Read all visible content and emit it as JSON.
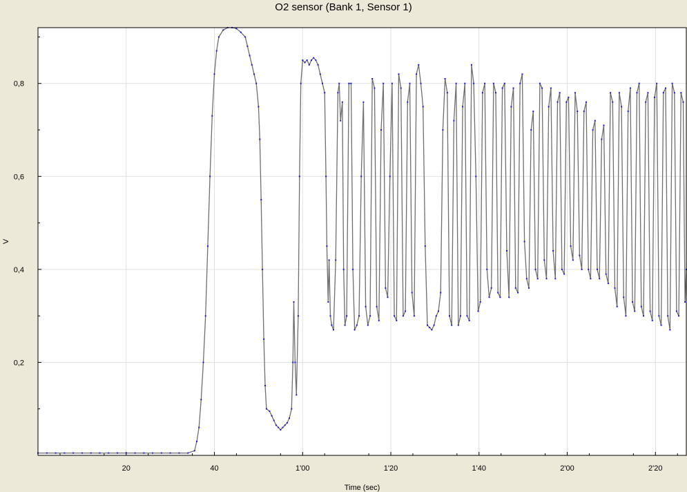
{
  "chart_data": {
    "type": "line",
    "title": "O2 sensor (Bank 1, Sensor 1)",
    "xlabel": "Time (sec)",
    "ylabel": "V",
    "xlim": [
      0,
      147
    ],
    "ylim": [
      0.0,
      0.92
    ],
    "grid": true,
    "x_ticks": [
      {
        "value": 20,
        "label": "20"
      },
      {
        "value": 40,
        "label": "40"
      },
      {
        "value": 60,
        "label": "1'00"
      },
      {
        "value": 80,
        "label": "1'20"
      },
      {
        "value": 100,
        "label": "1'40"
      },
      {
        "value": 120,
        "label": "2'00"
      },
      {
        "value": 140,
        "label": "2'20"
      }
    ],
    "y_ticks": [
      {
        "value": 0.2,
        "label": "0,2"
      },
      {
        "value": 0.4,
        "label": "0,4"
      },
      {
        "value": 0.6,
        "label": "0,6"
      },
      {
        "value": 0.8,
        "label": "0,8"
      }
    ],
    "colors": {
      "line": "#6e6e6e",
      "marker": "#1a1ad6",
      "grid": "#e0e0e0",
      "background": "#ffffff",
      "frame": "#ece9d8"
    },
    "series": [
      {
        "points": [
          [
            0,
            0.005
          ],
          [
            2,
            0.005
          ],
          [
            4,
            0.005
          ],
          [
            6,
            0.005
          ],
          [
            8,
            0.005
          ],
          [
            10,
            0.005
          ],
          [
            12,
            0.005
          ],
          [
            14,
            0.005
          ],
          [
            16,
            0.005
          ],
          [
            18,
            0.005
          ],
          [
            20,
            0.005
          ],
          [
            22,
            0.005
          ],
          [
            24,
            0.005
          ],
          [
            26,
            0.005
          ],
          [
            28,
            0.005
          ],
          [
            30,
            0.005
          ],
          [
            32,
            0.005
          ],
          [
            34,
            0.005
          ],
          [
            35.5,
            0.01
          ],
          [
            36,
            0.03
          ],
          [
            36.5,
            0.06
          ],
          [
            37,
            0.12
          ],
          [
            37.5,
            0.2
          ],
          [
            38,
            0.3
          ],
          [
            38.5,
            0.45
          ],
          [
            39,
            0.6
          ],
          [
            39.5,
            0.73
          ],
          [
            40,
            0.82
          ],
          [
            40.5,
            0.87
          ],
          [
            41,
            0.9
          ],
          [
            42,
            0.915
          ],
          [
            43,
            0.92
          ],
          [
            44,
            0.92
          ],
          [
            45,
            0.918
          ],
          [
            46,
            0.91
          ],
          [
            47,
            0.9
          ],
          [
            47.5,
            0.88
          ],
          [
            48,
            0.86
          ],
          [
            48.5,
            0.84
          ],
          [
            49,
            0.82
          ],
          [
            49.5,
            0.8
          ],
          [
            50,
            0.75
          ],
          [
            50.3,
            0.68
          ],
          [
            50.6,
            0.55
          ],
          [
            50.9,
            0.4
          ],
          [
            51.2,
            0.25
          ],
          [
            51.5,
            0.15
          ],
          [
            51.8,
            0.1
          ],
          [
            52.5,
            0.095
          ],
          [
            53,
            0.085
          ],
          [
            53.5,
            0.075
          ],
          [
            54,
            0.065
          ],
          [
            54.5,
            0.06
          ],
          [
            55,
            0.055
          ],
          [
            55.5,
            0.06
          ],
          [
            56,
            0.065
          ],
          [
            56.5,
            0.07
          ],
          [
            57,
            0.08
          ],
          [
            57.5,
            0.1
          ],
          [
            57.8,
            0.2
          ],
          [
            58,
            0.33
          ],
          [
            58.3,
            0.2
          ],
          [
            58.6,
            0.13
          ],
          [
            59,
            0.3
          ],
          [
            59.3,
            0.6
          ],
          [
            59.6,
            0.8
          ],
          [
            60,
            0.85
          ],
          [
            60.5,
            0.845
          ],
          [
            61,
            0.85
          ],
          [
            61.5,
            0.84
          ],
          [
            62,
            0.85
          ],
          [
            62.5,
            0.855
          ],
          [
            63,
            0.85
          ],
          [
            63.5,
            0.84
          ],
          [
            64,
            0.82
          ],
          [
            64.5,
            0.8
          ],
          [
            65,
            0.78
          ],
          [
            65.3,
            0.6
          ],
          [
            65.5,
            0.45
          ],
          [
            65.8,
            0.33
          ],
          [
            66,
            0.42
          ],
          [
            66.3,
            0.3
          ],
          [
            66.6,
            0.28
          ],
          [
            67,
            0.27
          ],
          [
            67.5,
            0.42
          ],
          [
            68,
            0.78
          ],
          [
            68.3,
            0.8
          ],
          [
            68.6,
            0.72
          ],
          [
            69,
            0.76
          ],
          [
            69.3,
            0.4
          ],
          [
            69.6,
            0.28
          ],
          [
            70,
            0.3
          ],
          [
            70.5,
            0.8
          ],
          [
            71,
            0.8
          ],
          [
            71.4,
            0.4
          ],
          [
            71.8,
            0.27
          ],
          [
            72.3,
            0.28
          ],
          [
            72.8,
            0.3
          ],
          [
            73.3,
            0.6
          ],
          [
            73.8,
            0.76
          ],
          [
            74.3,
            0.32
          ],
          [
            74.8,
            0.28
          ],
          [
            75.3,
            0.3
          ],
          [
            75.8,
            0.81
          ],
          [
            76.3,
            0.79
          ],
          [
            76.8,
            0.32
          ],
          [
            77.3,
            0.29
          ],
          [
            77.8,
            0.7
          ],
          [
            78.3,
            0.8
          ],
          [
            78.8,
            0.36
          ],
          [
            79.3,
            0.34
          ],
          [
            79.8,
            0.6
          ],
          [
            80.3,
            0.8
          ],
          [
            80.8,
            0.3
          ],
          [
            81.3,
            0.29
          ],
          [
            81.8,
            0.82
          ],
          [
            82.3,
            0.79
          ],
          [
            82.8,
            0.3
          ],
          [
            83.3,
            0.31
          ],
          [
            83.8,
            0.76
          ],
          [
            84.3,
            0.8
          ],
          [
            84.8,
            0.35
          ],
          [
            85.3,
            0.3
          ],
          [
            85.8,
            0.82
          ],
          [
            86.3,
            0.84
          ],
          [
            86.8,
            0.8
          ],
          [
            87.3,
            0.75
          ],
          [
            87.8,
            0.45
          ],
          [
            88.3,
            0.28
          ],
          [
            88.8,
            0.275
          ],
          [
            89.3,
            0.27
          ],
          [
            89.8,
            0.28
          ],
          [
            90.3,
            0.3
          ],
          [
            90.8,
            0.31
          ],
          [
            91.3,
            0.35
          ],
          [
            91.8,
            0.7
          ],
          [
            92.3,
            0.81
          ],
          [
            92.8,
            0.78
          ],
          [
            93.3,
            0.3
          ],
          [
            93.8,
            0.28
          ],
          [
            94.3,
            0.72
          ],
          [
            94.8,
            0.8
          ],
          [
            95.3,
            0.28
          ],
          [
            95.8,
            0.3
          ],
          [
            96.3,
            0.75
          ],
          [
            96.8,
            0.8
          ],
          [
            97.3,
            0.3
          ],
          [
            97.8,
            0.29
          ],
          [
            98.3,
            0.84
          ],
          [
            98.8,
            0.8
          ],
          [
            99.3,
            0.6
          ],
          [
            99.8,
            0.31
          ],
          [
            100.3,
            0.33
          ],
          [
            100.8,
            0.78
          ],
          [
            101.3,
            0.8
          ],
          [
            101.8,
            0.4
          ],
          [
            102.3,
            0.34
          ],
          [
            102.8,
            0.36
          ],
          [
            103.3,
            0.8
          ],
          [
            103.8,
            0.78
          ],
          [
            104.3,
            0.35
          ],
          [
            104.8,
            0.34
          ],
          [
            105.3,
            0.79
          ],
          [
            105.8,
            0.8
          ],
          [
            106.3,
            0.44
          ],
          [
            106.8,
            0.34
          ],
          [
            107.3,
            0.75
          ],
          [
            107.8,
            0.79
          ],
          [
            108.3,
            0.36
          ],
          [
            108.8,
            0.35
          ],
          [
            109.3,
            0.8
          ],
          [
            109.8,
            0.82
          ],
          [
            110.3,
            0.46
          ],
          [
            110.8,
            0.38
          ],
          [
            111.3,
            0.36
          ],
          [
            111.8,
            0.7
          ],
          [
            112.3,
            0.74
          ],
          [
            112.8,
            0.4
          ],
          [
            113.3,
            0.38
          ],
          [
            113.8,
            0.8
          ],
          [
            114.3,
            0.79
          ],
          [
            114.8,
            0.42
          ],
          [
            115.3,
            0.38
          ],
          [
            115.8,
            0.75
          ],
          [
            116.3,
            0.79
          ],
          [
            116.8,
            0.44
          ],
          [
            117.3,
            0.38
          ],
          [
            117.8,
            0.76
          ],
          [
            118.3,
            0.78
          ],
          [
            118.8,
            0.4
          ],
          [
            119.3,
            0.39
          ],
          [
            119.8,
            0.76
          ],
          [
            120.3,
            0.77
          ],
          [
            120.8,
            0.45
          ],
          [
            121.3,
            0.42
          ],
          [
            121.8,
            0.78
          ],
          [
            122.3,
            0.74
          ],
          [
            122.8,
            0.43
          ],
          [
            123.3,
            0.4
          ],
          [
            123.8,
            0.74
          ],
          [
            124.3,
            0.76
          ],
          [
            124.8,
            0.4
          ],
          [
            125.3,
            0.38
          ],
          [
            125.8,
            0.7
          ],
          [
            126.3,
            0.72
          ],
          [
            126.8,
            0.4
          ],
          [
            127.3,
            0.38
          ],
          [
            127.8,
            0.68
          ],
          [
            128.3,
            0.71
          ],
          [
            128.8,
            0.39
          ],
          [
            129.3,
            0.37
          ],
          [
            129.8,
            0.78
          ],
          [
            130.3,
            0.76
          ],
          [
            130.8,
            0.36
          ],
          [
            131.3,
            0.32
          ],
          [
            131.8,
            0.78
          ],
          [
            132.3,
            0.75
          ],
          [
            132.8,
            0.34
          ],
          [
            133.3,
            0.3
          ],
          [
            133.8,
            0.74
          ],
          [
            134.3,
            0.79
          ],
          [
            134.8,
            0.33
          ],
          [
            135.3,
            0.31
          ],
          [
            135.8,
            0.78
          ],
          [
            136.3,
            0.8
          ],
          [
            136.8,
            0.32
          ],
          [
            137.3,
            0.3
          ],
          [
            137.8,
            0.76
          ],
          [
            138.3,
            0.78
          ],
          [
            138.8,
            0.31
          ],
          [
            139.3,
            0.29
          ],
          [
            139.8,
            0.77
          ],
          [
            140.3,
            0.8
          ],
          [
            140.8,
            0.3
          ],
          [
            141.3,
            0.28
          ],
          [
            141.8,
            0.78
          ],
          [
            142.3,
            0.79
          ],
          [
            142.8,
            0.3
          ],
          [
            143.3,
            0.27
          ],
          [
            143.8,
            0.8
          ],
          [
            144.3,
            0.78
          ],
          [
            144.8,
            0.31
          ],
          [
            145.3,
            0.3
          ],
          [
            145.8,
            0.78
          ],
          [
            146.3,
            0.76
          ],
          [
            146.7,
            0.33
          ],
          [
            147,
            0.4
          ]
        ]
      }
    ]
  }
}
